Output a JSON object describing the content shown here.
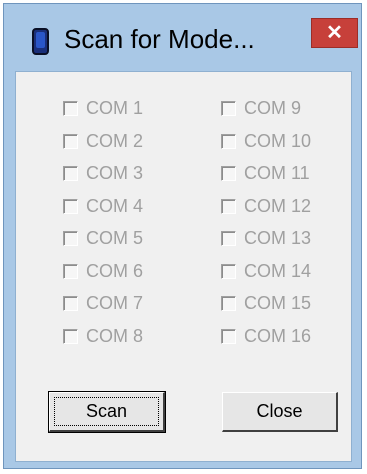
{
  "window": {
    "title": "Scan for Mode...",
    "close_glyph": "✕",
    "icon": "device-icon"
  },
  "ports_left": [
    "COM 1",
    "COM 2",
    "COM 3",
    "COM 4",
    "COM 5",
    "COM 6",
    "COM 7",
    "COM 8"
  ],
  "ports_right": [
    "COM 9",
    "COM 10",
    "COM 11",
    "COM 12",
    "COM 13",
    "COM 14",
    "COM 15",
    "COM 16"
  ],
  "buttons": {
    "scan_label": "Scan",
    "close_label": "Close"
  },
  "colors": {
    "frame": "#a9c8e6",
    "close_button": "#c7403a",
    "disabled_text": "#a0a0a0"
  }
}
